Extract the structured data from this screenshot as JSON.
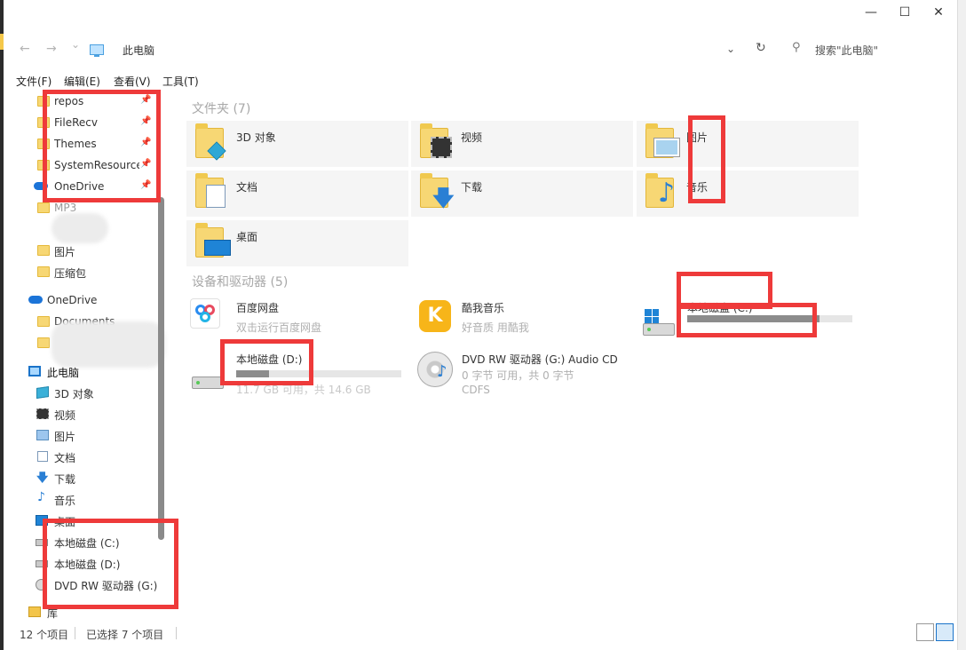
{
  "window": {
    "min_glyph": "—",
    "max_glyph": "☐",
    "close_glyph": "✕"
  },
  "address": {
    "back_glyph": "←",
    "forward_glyph": "→",
    "recent_glyph": "⌄",
    "path": "此电脑",
    "dropdown_glyph": "⌄",
    "refresh_glyph": "↻",
    "search_glyph": "⚲",
    "search_placeholder": "搜索\"此电脑\""
  },
  "menu": [
    "文件(F)",
    "编辑(E)",
    "查看(V)",
    "工具(T)"
  ],
  "sidebar": {
    "pinned": [
      {
        "label": "repos",
        "icon": "folder-icon"
      },
      {
        "label": "FileRecv",
        "icon": "folder-icon"
      },
      {
        "label": "Themes",
        "icon": "folder-icon"
      },
      {
        "label": "SystemResources",
        "icon": "folder-icon"
      },
      {
        "label": "OneDrive",
        "icon": "onedrive-icon"
      }
    ],
    "quick": [
      {
        "label": "MP3",
        "icon": "folder-icon"
      },
      {
        "label": "图片",
        "icon": "folder-icon"
      },
      {
        "label": "压缩包",
        "icon": "folder-icon"
      }
    ],
    "onedrive": {
      "label": "OneDrive",
      "children": [
        "Documents"
      ]
    },
    "this_pc": {
      "label": "此电脑",
      "children": [
        {
          "label": "3D 对象",
          "icon": "cube-icon"
        },
        {
          "label": "视频",
          "icon": "video-icon"
        },
        {
          "label": "图片",
          "icon": "picture-icon"
        },
        {
          "label": "文档",
          "icon": "document-icon"
        },
        {
          "label": "下载",
          "icon": "download-icon"
        },
        {
          "label": "音乐",
          "icon": "music-icon"
        },
        {
          "label": "桌面",
          "icon": "desktop-icon"
        },
        {
          "label": "本地磁盘 (C:)",
          "icon": "drive-icon"
        },
        {
          "label": "本地磁盘 (D:)",
          "icon": "drive-icon"
        },
        {
          "label": "DVD RW 驱动器 (G:)",
          "icon": "dvd-icon"
        }
      ]
    },
    "library": {
      "label": "库"
    }
  },
  "main": {
    "folders_header": "文件夹 (7)",
    "folders": [
      "3D 对象",
      "视频",
      "图片",
      "文档",
      "下载",
      "音乐",
      "桌面"
    ],
    "devices_header": "设备和驱动器 (5)",
    "devices": [
      {
        "name": "百度网盘",
        "sub": "双击运行百度网盘"
      },
      {
        "name": "酷我音乐",
        "sub": "好音质 用酷我"
      },
      {
        "name": "本地磁盘 (C:)",
        "usage": 0.8
      },
      {
        "name": "本地磁盘 (D:)",
        "sub": "11.7 GB 可用，共 14.6 GB",
        "usage": 0.2
      },
      {
        "name": "DVD RW 驱动器 (G:) Audio CD",
        "sub": "0 字节 可用，共 0 字节",
        "sub2": "CDFS"
      }
    ]
  },
  "status": {
    "count": "12 个项目",
    "selected": "已选择 7 个项目"
  },
  "accent": "#1a73c9",
  "highlight_color": "#ee3a3a"
}
